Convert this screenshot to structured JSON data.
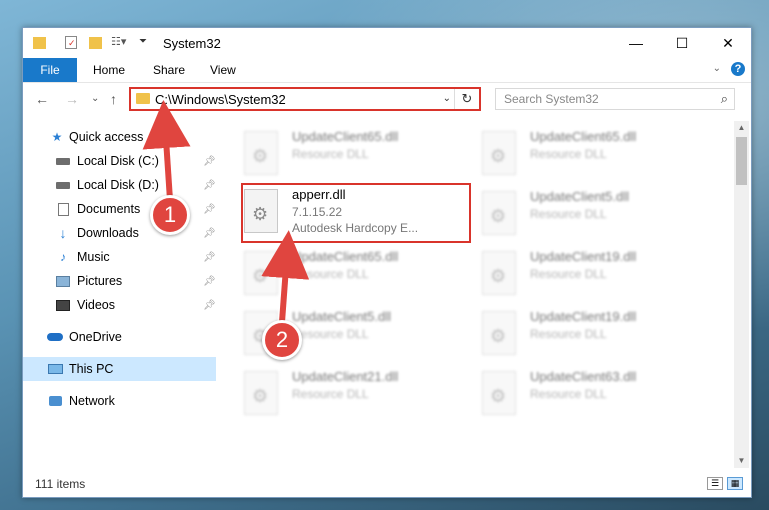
{
  "window": {
    "title": "System32",
    "controls": {
      "minimize": "—",
      "maximize": "☐",
      "close": "✕"
    }
  },
  "ribbon": {
    "tabs": [
      {
        "label": "File"
      },
      {
        "label": "Home"
      },
      {
        "label": "Share"
      },
      {
        "label": "View"
      }
    ]
  },
  "nav": {
    "address": "C:\\Windows\\System32",
    "search_placeholder": "Search System32"
  },
  "sidebar": {
    "items": [
      {
        "label": "Quick access",
        "icon": "star-icon"
      },
      {
        "label": "Local Disk (C:)",
        "icon": "drive-icon",
        "pinned": true
      },
      {
        "label": "Local Disk (D:)",
        "icon": "drive-icon",
        "pinned": true
      },
      {
        "label": "Documents",
        "icon": "documents-icon",
        "pinned": true
      },
      {
        "label": "Downloads",
        "icon": "downloads-icon",
        "pinned": true
      },
      {
        "label": "Music",
        "icon": "music-icon",
        "pinned": true
      },
      {
        "label": "Pictures",
        "icon": "pictures-icon",
        "pinned": true
      },
      {
        "label": "Videos",
        "icon": "videos-icon",
        "pinned": true
      },
      {
        "label": "OneDrive",
        "icon": "cloud-icon"
      },
      {
        "label": "This PC",
        "icon": "computer-icon",
        "selected": true
      },
      {
        "label": "Network",
        "icon": "network-icon"
      }
    ]
  },
  "files": {
    "left_column": [
      {
        "name": "UpdateClient65.dll",
        "line2": "Resource DLL"
      },
      {
        "name": "apperr.dll",
        "line2": "7.1.15.22",
        "line3": "Autodesk Hardcopy E..."
      },
      {
        "name": "UpdateClient65.dll",
        "line2": "Resource DLL"
      },
      {
        "name": "UpdateClient5.dll",
        "line2": "Resource DLL"
      },
      {
        "name": "UpdateClient21.dll",
        "line2": "Resource DLL"
      }
    ],
    "right_column": [
      {
        "name": "UpdateClient65.dll",
        "line2": "Resource DLL"
      },
      {
        "name": "UpdateClient5.dll",
        "line2": "Resource DLL"
      },
      {
        "name": "UpdateClient19.dll",
        "line2": "Resource DLL"
      },
      {
        "name": "UpdateClient19.dll",
        "line2": "Resource DLL"
      },
      {
        "name": "UpdateClient63.dll",
        "line2": "Resource DLL"
      }
    ]
  },
  "status": {
    "item_count": "111 items"
  },
  "annotations": {
    "step1": "1",
    "step2": "2",
    "color": "#e0453f"
  }
}
